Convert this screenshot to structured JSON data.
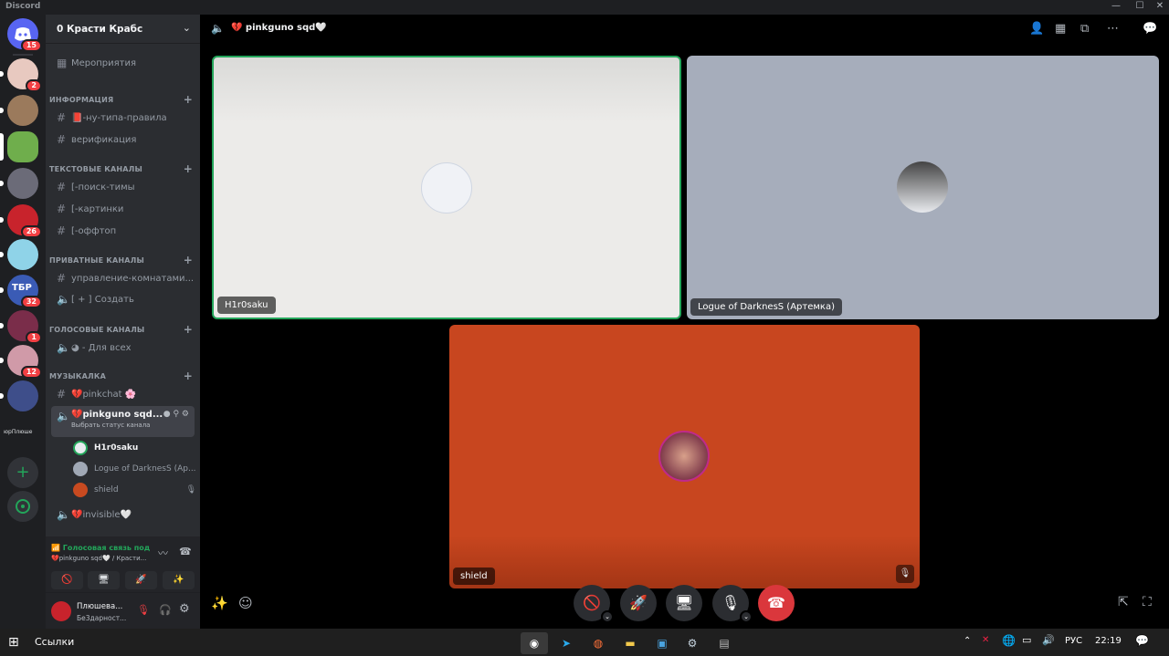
{
  "window": {
    "title": "Discord",
    "controls": [
      "—",
      "☐",
      "✕"
    ]
  },
  "rail": {
    "home_badge": "15",
    "servers": [
      {
        "name": "server-1",
        "badge": "2",
        "color": "#e8c9c0"
      },
      {
        "name": "server-2",
        "badge": "",
        "color": "#9b7a5c"
      },
      {
        "name": "server-3",
        "badge": "",
        "color": "#6fae4c",
        "active": true
      },
      {
        "name": "server-4",
        "badge": "",
        "color": "#6b6b78"
      },
      {
        "name": "server-5",
        "badge": "26",
        "color": "#c8232c"
      },
      {
        "name": "server-6",
        "badge": "",
        "color": "#8fd3e8"
      },
      {
        "name": "server-7",
        "badge": "32",
        "color": "#3a5bb5",
        "text": "ТБР"
      },
      {
        "name": "server-8",
        "badge": "1",
        "color": "#7a2d4a"
      },
      {
        "name": "server-9",
        "badge": "12",
        "color": "#d09aa8"
      },
      {
        "name": "server-10",
        "badge": "",
        "color": "#3e4e8a"
      }
    ],
    "folder_label": "юрПлюше"
  },
  "sidebar": {
    "guild_name": "Красти Крабс",
    "events_label": "Мероприятия",
    "categories": [
      {
        "name": "ИНФОРМАЦИЯ",
        "channels": [
          {
            "type": "text",
            "name": "-ну-типа-правила",
            "emoji": "📕"
          },
          {
            "type": "text",
            "name": "верификация"
          }
        ]
      },
      {
        "name": "ТЕКСТОВЫЕ КАНАЛЫ",
        "channels": [
          {
            "type": "text",
            "name": "[-поиск-тимы"
          },
          {
            "type": "text",
            "name": "[-картинки"
          },
          {
            "type": "text",
            "name": "[-оффтоп"
          }
        ]
      },
      {
        "name": "ПРИВАТНЫЕ КАНАЛЫ",
        "channels": [
          {
            "type": "text",
            "name": "управление-комнатами..."
          },
          {
            "type": "voice",
            "name": "[ + ] Создать"
          }
        ]
      },
      {
        "name": "ГОЛОСОВЫЕ КАНАЛЫ",
        "channels": [
          {
            "type": "voice",
            "name": "◕ - Для всех"
          }
        ]
      },
      {
        "name": "МУЗЫКАЛКА",
        "channels": [
          {
            "type": "text",
            "name": "pinkchat 🌸",
            "emoji": "💔"
          },
          {
            "type": "voice",
            "name": "pinkguno sqd...",
            "emoji": "💔",
            "status": "Выбрать статус канала",
            "active": true
          },
          {
            "type": "voice",
            "name": "invisible🤍",
            "emoji": "💔"
          }
        ]
      }
    ],
    "voice_users": [
      {
        "name": "H1r0saku",
        "color": "#e8ecf0"
      },
      {
        "name": "Logue of DarknesS (Ар...",
        "color": "#a0a8b5"
      },
      {
        "name": "shield",
        "color": "#c84a20"
      }
    ]
  },
  "voice_panel": {
    "status": "Голосовая связь под",
    "channel": "💔pinkguno sqd🤍 / Красти...",
    "buttons": [
      "🚫",
      "🖥",
      "🚀",
      "✨"
    ]
  },
  "user_panel": {
    "name": "Плюшева...",
    "status": "Бе3дарност..."
  },
  "main": {
    "channel_title": "💔 pinkguno sqd🤍",
    "tiles": [
      {
        "name": "H1r0saku",
        "bg": "#ecebe9"
      },
      {
        "name": "Logue of DarknesS (Артемка)",
        "bg": "#a6adbb"
      },
      {
        "name": "shield",
        "bg": "#c8461f"
      }
    ]
  },
  "taskbar": {
    "search_label": "Ссылки",
    "language": "РУС",
    "time": "22:19"
  }
}
